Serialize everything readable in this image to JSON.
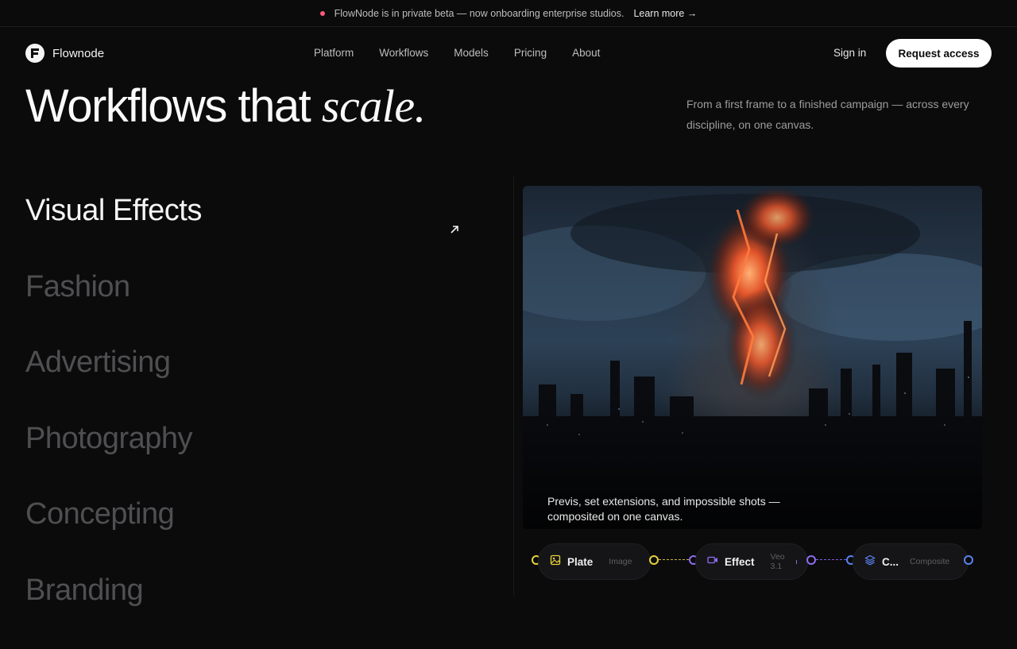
{
  "banner": {
    "text": "FlowNode is in private beta — now onboarding enterprise studios.",
    "link": "Learn more →",
    "dot_color": "#ff5b7a"
  },
  "brand": {
    "name": "Flownode",
    "logo_glyph": "F"
  },
  "nav": {
    "links": [
      "Platform",
      "Workflows",
      "Models",
      "Pricing",
      "About"
    ],
    "signin": "Sign in",
    "cta": "Request access"
  },
  "hero": {
    "headline_a": "Workflows that ",
    "headline_b": "scale.",
    "subtext": "From a first frame to a finished campaign — across every discipline, on one canvas."
  },
  "categories": [
    "Visual Effects",
    "Fashion",
    "Advertising",
    "Photography",
    "Concepting",
    "Branding"
  ],
  "active_category": "Visual Effects",
  "showcase": {
    "caption": "Previs, set extensions, and impossible shots — composited on one canvas."
  },
  "pipeline": [
    {
      "label": "Plate",
      "type": "Image",
      "icon": "image-icon",
      "color": "#e6d13a"
    },
    {
      "label": "Effect",
      "type": "Veo 3.1",
      "icon": "video-icon",
      "color": "#8f6cf2"
    },
    {
      "label": "C...",
      "type": "Composite",
      "icon": "layers-icon",
      "color": "#5b82f0"
    }
  ]
}
